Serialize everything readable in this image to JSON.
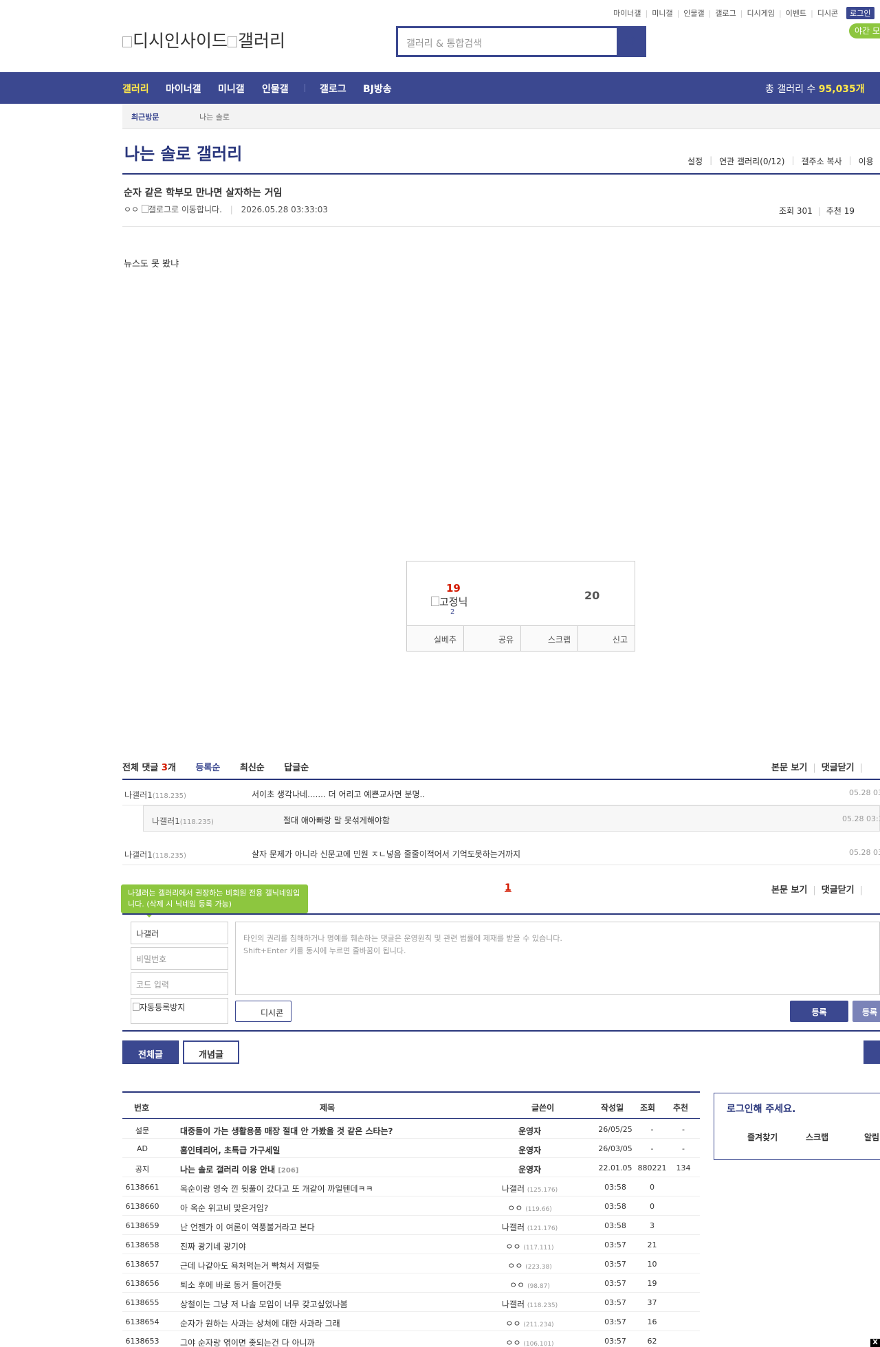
{
  "top_links": [
    "마이너갤",
    "미니갤",
    "인물갤",
    "갤로그",
    "디시게임",
    "이벤트",
    "디시콘"
  ],
  "login_label": "로그인",
  "night_mode": "야간 모드",
  "logo_alt": "디시인사이드",
  "logo_alt2": "갤러리",
  "search_placeholder": "갤러리 & 통합검색",
  "nav": {
    "items": [
      "갤러리",
      "마이너갤",
      "미니갤",
      "인물갤",
      "갤로그",
      "BJ방송"
    ],
    "total_label": "총 갤러리 수",
    "total_value": "95,035개"
  },
  "recent": {
    "label": "최근방문",
    "value": "나는 솔로"
  },
  "gallery_title": "나는 솔로 갤러리",
  "gallery_tools": [
    "설정",
    "연관 갤러리(0/12)",
    "갤주소 복사",
    "이용"
  ],
  "post": {
    "title": "순자 같은 학부모 만나면 살자하는 거임",
    "author": "ㅇㅇ",
    "gallog_alt": "갤로그로 이동합니다.",
    "date": "2026.05.28 03:33:03",
    "view_label": "조회 301",
    "rec_label": "추천 19",
    "body": "뉴스도 못 봤냐"
  },
  "vote": {
    "up": "19",
    "down": "20",
    "gonick": "고정닉",
    "gonick_count": "2",
    "buttons": [
      "실베추",
      "공유",
      "스크랩",
      "신고"
    ]
  },
  "comments": {
    "label": "전체 댓글",
    "count": "3",
    "unit": "개",
    "tabs": [
      "등록순",
      "최신순",
      "답글순"
    ],
    "right": [
      "본문 보기",
      "댓글닫기"
    ],
    "items": [
      {
        "nick": "나갤러1",
        "ip": "(118.235)",
        "text": "서이초 생각나네....... 더 어리고 예쁜교사면 분명..",
        "time": "05.28 03"
      },
      {
        "nick": "나갤러1",
        "ip": "(118.235)",
        "text": "절대 애아빠랑 말 못섞게해야함",
        "time": "05.28 03:3"
      },
      {
        "nick": "나갤러1",
        "ip": "(118.235)",
        "text": "살자 문제가 아니라 신문고에 민원 ㅈㄴ넣음 줄줄이적어서 기억도못하는거까지",
        "time": "05.28 03"
      }
    ],
    "page": "1"
  },
  "comment_form": {
    "tooltip": "나갤러는 갤러리에서 권장하는 비회원 전용 갤닉네임입니다. (삭제 시 닉네임 등록 가능)",
    "nick_value": "나갤러",
    "pw_placeholder": "비밀번호",
    "code_placeholder": "코드 입력",
    "captcha_alt": "자동등록방지",
    "text_placeholder_1": "타인의 권리를 침해하거나 명예를 훼손하는 댓글은 운영원칙 및 관련 법률에 제재를 받을 수 있습니다.",
    "text_placeholder_2": "Shift+Enter 키를 동시에 누르면 줄바꿈이 됩니다.",
    "dccon": "디시콘",
    "register": "등록",
    "register2": "등록"
  },
  "list_buttons": {
    "all": "전체글",
    "concept": "개념글"
  },
  "list": {
    "headers": [
      "번호",
      "제목",
      "글쓴이",
      "작성일",
      "조회",
      "추천"
    ],
    "notices": [
      {
        "num": "설문",
        "subject": "대중들이 가는 생활용품 매장 절대 안 가봤을 것 같은 스타는?",
        "writer": "운영자",
        "date": "26/05/25",
        "view": "-",
        "rec": "-"
      },
      {
        "num": "AD",
        "subject": "홈인테리어, 초특급 가구세일",
        "writer": "운영자",
        "date": "26/03/05",
        "view": "-",
        "rec": "-"
      },
      {
        "num": "공지",
        "subject": "나는 솔로 갤러리 이용 안내",
        "reply": "[206]",
        "writer": "운영자",
        "date": "22.01.05",
        "view": "880221",
        "rec": "134"
      }
    ],
    "rows": [
      {
        "num": "6138661",
        "subject": "옥순이랑 영숙 낀 뒷풀이 갔다고 또 개같이 까일텐데ㅋㅋ",
        "writer": "나갤러",
        "ip": "(125.176)",
        "date": "03:58",
        "view": "0",
        "rec": ""
      },
      {
        "num": "6138660",
        "subject": "아 옥순 위고비 맞은거임?",
        "writer": "ㅇㅇ",
        "ip": "(119.66)",
        "date": "03:58",
        "view": "0",
        "rec": ""
      },
      {
        "num": "6138659",
        "subject": "난 언젠가 이 여론이 역풍불거라고 본다",
        "writer": "나갤러",
        "ip": "(121.176)",
        "date": "03:58",
        "view": "3",
        "rec": ""
      },
      {
        "num": "6138658",
        "subject": "진짜 광기네 광기야",
        "writer": "ㅇㅇ",
        "ip": "(117.111)",
        "date": "03:57",
        "view": "21",
        "rec": ""
      },
      {
        "num": "6138657",
        "subject": "근데 나같아도 욕처먹는거 빡쳐서 저럴듯",
        "writer": "ㅇㅇ",
        "ip": "(223.38)",
        "date": "03:57",
        "view": "10",
        "rec": ""
      },
      {
        "num": "6138656",
        "subject": "퇴소 후에 바로 동거 들어간듯",
        "writer": "ㅇㅇ",
        "ip": "(98.87)",
        "date": "03:57",
        "view": "19",
        "rec": ""
      },
      {
        "num": "6138655",
        "subject": "상철이는 그냥 저 나솔 모임이 너무 갖고싶었나봄",
        "writer": "나갤러",
        "ip": "(118.235)",
        "date": "03:57",
        "view": "37",
        "rec": ""
      },
      {
        "num": "6138654",
        "subject": "순자가 원하는 사과는 상처에 대한 사과라 그래",
        "writer": "ㅇㅇ",
        "ip": "(211.234)",
        "date": "03:57",
        "view": "16",
        "rec": ""
      },
      {
        "num": "6138653",
        "subject": "그야 순자랑 엮이면 좆되는건 다 아니까",
        "writer": "ㅇㅇ",
        "ip": "(106.101)",
        "date": "03:57",
        "view": "62",
        "rec": ""
      }
    ]
  },
  "login_box": {
    "title": "로그인해 주세요.",
    "links": [
      "즐겨찾기",
      "스크랩",
      "알림"
    ]
  },
  "close_label": "X",
  "colors": {
    "brand": "#3b4890",
    "brand_dark": "#29367c",
    "accent_yellow": "#ffe84a",
    "accent_red": "#d31900",
    "green": "#8dc63f"
  }
}
